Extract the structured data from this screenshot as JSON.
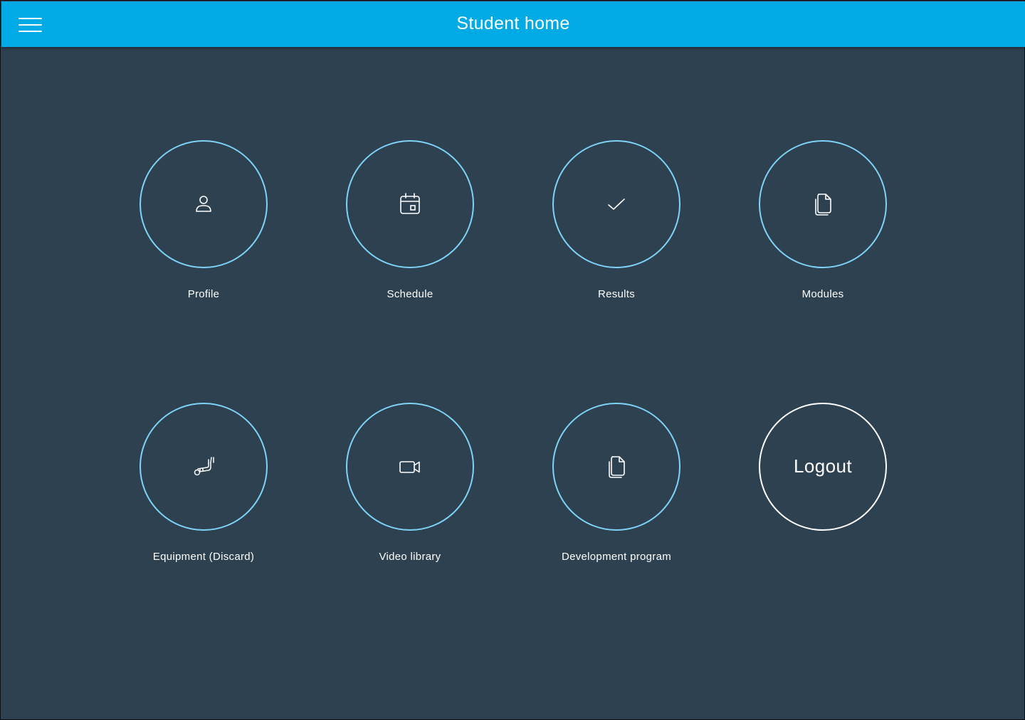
{
  "header": {
    "title": "Student home",
    "menu_icon": "hamburger-menu-icon",
    "background": "#00aae5"
  },
  "colors": {
    "page_background": "#2e4150",
    "tile_border": "#7ed3f7",
    "logout_border": "#ffffff",
    "text": "#ffffff"
  },
  "tiles": [
    {
      "label": "Profile",
      "icon": "user-icon"
    },
    {
      "label": "Schedule",
      "icon": "calendar-icon"
    },
    {
      "label": "Results",
      "icon": "checkmark-icon"
    },
    {
      "label": "Modules",
      "icon": "documents-icon"
    },
    {
      "label": "Equipment (Discard)",
      "icon": "golf-bag-icon"
    },
    {
      "label": "Video library",
      "icon": "video-camera-icon"
    },
    {
      "label": "Development program",
      "icon": "documents-icon"
    }
  ],
  "logout": {
    "label": "Logout"
  }
}
